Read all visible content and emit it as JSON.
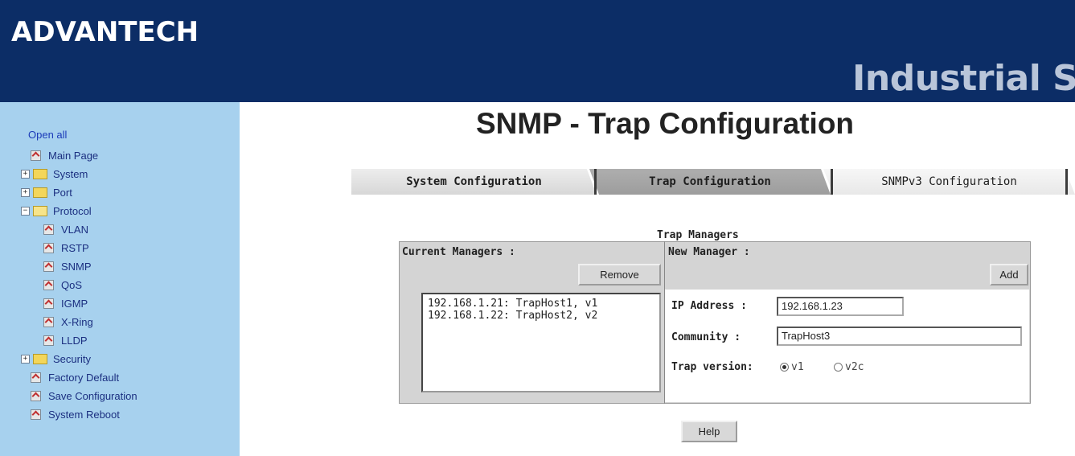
{
  "header": {
    "logo_text": "ADVANTECH",
    "brand_text": "Industrial S"
  },
  "sidebar": {
    "open_all": "Open all",
    "items": [
      {
        "label": "Main Page",
        "icon": "page-icon"
      },
      {
        "label": "System",
        "icon": "folder-icon",
        "expander": "+"
      },
      {
        "label": "Port",
        "icon": "folder-icon",
        "expander": "+"
      },
      {
        "label": "Protocol",
        "icon": "folder-open-icon",
        "expander": "−"
      },
      {
        "label": "VLAN",
        "icon": "page-icon"
      },
      {
        "label": "RSTP",
        "icon": "page-icon"
      },
      {
        "label": "SNMP",
        "icon": "page-icon"
      },
      {
        "label": "QoS",
        "icon": "page-icon"
      },
      {
        "label": "IGMP",
        "icon": "page-icon"
      },
      {
        "label": "X-Ring",
        "icon": "page-icon"
      },
      {
        "label": "LLDP",
        "icon": "page-icon"
      },
      {
        "label": "Security",
        "icon": "folder-icon",
        "expander": "+"
      },
      {
        "label": "Factory Default",
        "icon": "page-icon"
      },
      {
        "label": "Save Configuration",
        "icon": "page-icon"
      },
      {
        "label": "System Reboot",
        "icon": "page-icon"
      }
    ]
  },
  "main": {
    "title": "SNMP - Trap Configuration",
    "tabs": [
      {
        "label": "System Configuration"
      },
      {
        "label": "Trap Configuration"
      },
      {
        "label": "SNMPv3 Configuration"
      }
    ],
    "section_title": "Trap Managers",
    "current_managers_label": "Current Managers :",
    "remove_label": "Remove",
    "managers": [
      "192.168.1.21: TrapHost1, v1",
      "192.168.1.22: TrapHost2, v2"
    ],
    "new_manager_label": "New Manager :",
    "add_label": "Add",
    "ip_label": "IP Address :",
    "ip_value": "192.168.1.23",
    "community_label": "Community :",
    "community_value": "TrapHost3",
    "trap_version_label": "Trap version:",
    "version_v1": "v1",
    "version_v2c": "v2c",
    "selected_version": "v1",
    "help_label": "Help"
  },
  "colors": {
    "header_bg": "#0c2d66",
    "sidebar_bg": "#a7d1ee",
    "panel_bg": "#d4d4d4"
  }
}
